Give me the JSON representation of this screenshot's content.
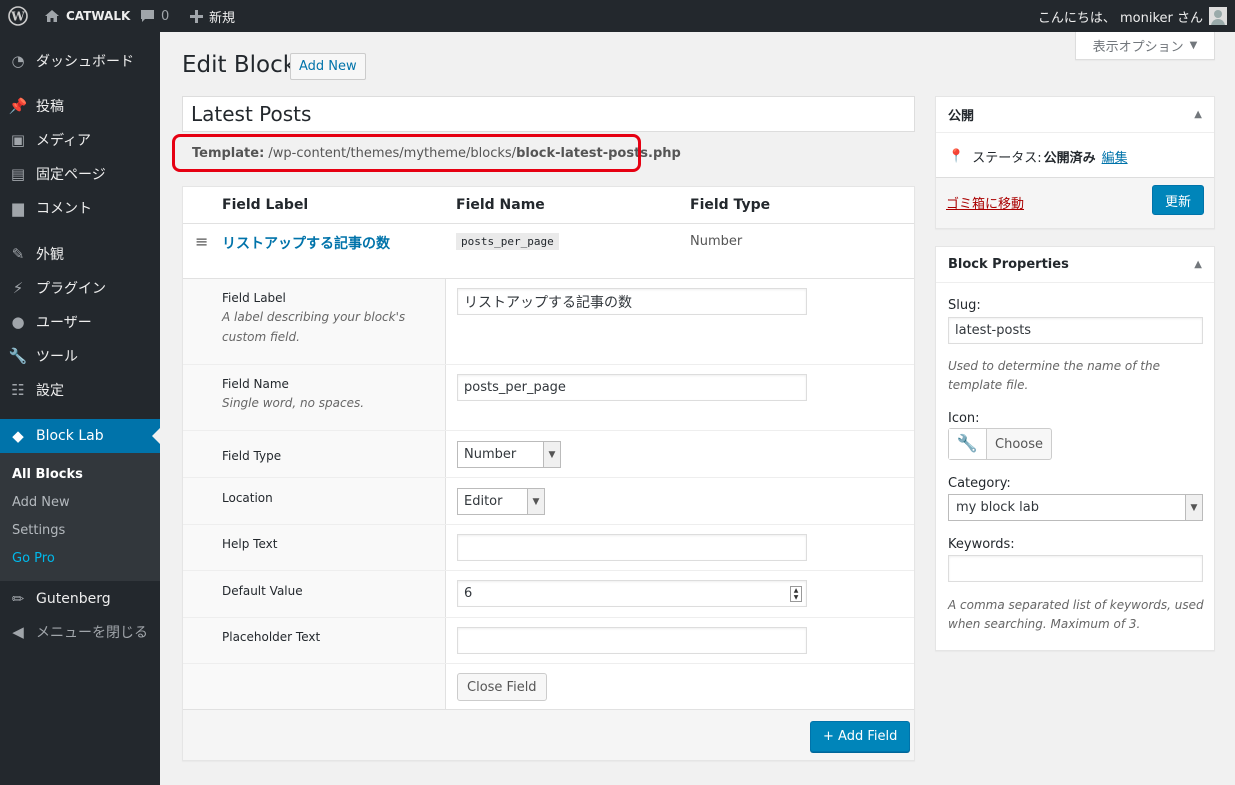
{
  "adminbar": {
    "site_name": "CATWALK",
    "comment_count": "0",
    "new_label": "新規",
    "greeting": "こんにちは、 moniker さん"
  },
  "menu": {
    "dashboard": "ダッシュボード",
    "posts": "投稿",
    "media": "メディア",
    "pages": "固定ページ",
    "comments": "コメント",
    "appearance": "外観",
    "plugins": "プラグイン",
    "users": "ユーザー",
    "tools": "ツール",
    "settings": "設定",
    "block_lab": "Block Lab",
    "sub": {
      "all_blocks": "All Blocks",
      "add_new": "Add New",
      "settings": "Settings",
      "go_pro": "Go Pro"
    },
    "gutenberg": "Gutenberg",
    "collapse": "メニューを閉じる"
  },
  "header": {
    "title": "Edit Block",
    "add_new": "Add New",
    "screen_options": "表示オプション"
  },
  "block": {
    "title": "Latest Posts",
    "template_label": "Template:",
    "template_path": " /wp-content/themes/mytheme/blocks/",
    "template_file": "block-latest-posts.php"
  },
  "fields_table": {
    "col_label": "Field Label",
    "col_name": "Field Name",
    "col_type": "Field Type",
    "row": {
      "label": "リストアップする記事の数",
      "name": "posts_per_page",
      "type": "Number"
    }
  },
  "field_settings": {
    "label_title": "Field Label",
    "label_desc": "A label describing your block's custom field.",
    "label_value": "リストアップする記事の数",
    "name_title": "Field Name",
    "name_desc": "Single word, no spaces.",
    "name_value": "posts_per_page",
    "type_title": "Field Type",
    "type_value": "Number",
    "location_title": "Location",
    "location_value": "Editor",
    "help_title": "Help Text",
    "help_value": "",
    "default_title": "Default Value",
    "default_value": "6",
    "placeholder_title": "Placeholder Text",
    "placeholder_value": "",
    "close_button": "Close Field",
    "add_field_button": "+ Add Field"
  },
  "publish": {
    "title": "公開",
    "status_label": "ステータス:",
    "status_value": "公開済み",
    "edit_link": "編集",
    "trash_link": "ゴミ箱に移動",
    "update_button": "更新"
  },
  "properties": {
    "title": "Block Properties",
    "slug_label": "Slug:",
    "slug_value": "latest-posts",
    "slug_desc": "Used to determine the name of the template file.",
    "icon_label": "Icon:",
    "icon_choose": "Choose",
    "icon_name": "wrench-icon",
    "category_label": "Category:",
    "category_value": "my block lab",
    "keywords_label": "Keywords:",
    "keywords_value": "",
    "keywords_desc": "A comma separated list of keywords, used when searching. Maximum of 3."
  },
  "colors": {
    "admin_dark": "#23282d",
    "accent_blue": "#0073aa",
    "button_blue": "#0085ba",
    "highlight_red": "#e60012"
  }
}
